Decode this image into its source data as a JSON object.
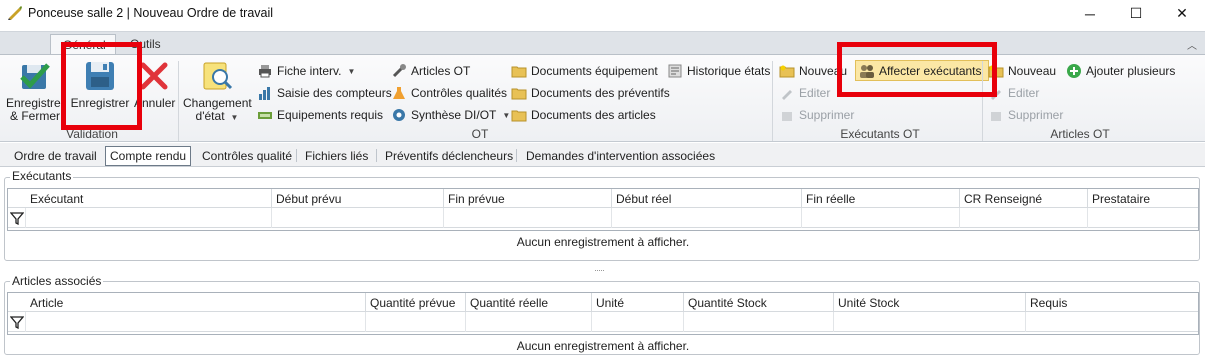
{
  "window": {
    "title": "Ponceuse salle 2 | Nouveau Ordre de travail",
    "controls": {
      "minimize": "─",
      "maximize": "☐",
      "close": "✕"
    }
  },
  "ribbon_tabs": [
    "Général",
    "Outils"
  ],
  "ribbon": {
    "validation": {
      "label": "Validation",
      "save_close": [
        "Enregistrer",
        "& Fermer"
      ],
      "save": "Enregistrer",
      "cancel": "Annuler"
    },
    "ot": {
      "label": "OT",
      "change_state": [
        "Changement",
        "d'état"
      ],
      "fiche_interv": "Fiche interv.",
      "saisie_compteurs": "Saisie des compteurs",
      "equipements_requis": "Equipements requis",
      "articles_ot": "Articles OT",
      "controles_qualites": "Contrôles qualités",
      "synthese": "Synthèse DI/OT",
      "docs_equipement": "Documents équipement",
      "docs_preventifs": "Documents des préventifs",
      "docs_articles": "Documents des articles",
      "historique_etats": "Historique états"
    },
    "executants_ot": {
      "label": "Exécutants OT",
      "nouveau": "Nouveau",
      "editer": "Editer",
      "supprimer": "Supprimer",
      "affecter": "Affecter exécutants"
    },
    "articles_ot": {
      "label": "Articles OT",
      "nouveau": "Nouveau",
      "ajouter": "Ajouter plusieurs",
      "editer": "Editer",
      "supprimer": "Supprimer"
    }
  },
  "content_tabs": [
    "Ordre de travail",
    "Compte rendu",
    "Contrôles qualité",
    "Fichiers liés",
    "Préventifs déclencheurs",
    "Demandes d'intervention associées"
  ],
  "active_content_tab": "Compte rendu",
  "executants_panel": {
    "legend": "Exécutants",
    "columns": [
      "Exécutant",
      "Début prévu",
      "Fin prévue",
      "Début réel",
      "Fin réelle",
      "CR Renseigné",
      "Prestataire"
    ],
    "empty": "Aucun enregistrement à afficher."
  },
  "articles_panel": {
    "legend": "Articles associés",
    "columns": [
      "Article",
      "Quantité prévue",
      "Quantité réelle",
      "Unité",
      "Quantité Stock",
      "Unité Stock",
      "Requis"
    ],
    "empty": "Aucun enregistrement à afficher."
  },
  "colors": {
    "highlight": "#e8000b",
    "affecter_bg": "#fbe7a5"
  }
}
